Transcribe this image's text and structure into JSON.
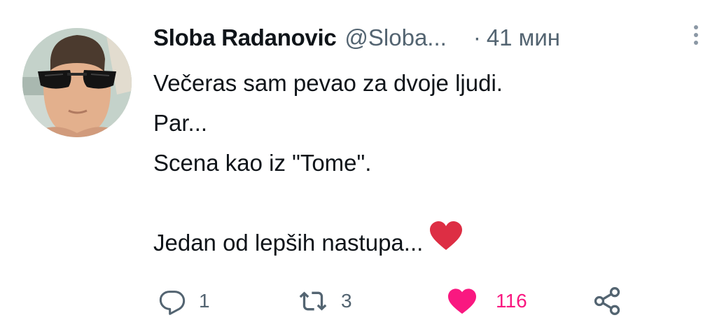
{
  "tweet": {
    "author": {
      "display_name": "Sloba Radanovic",
      "handle": "@Sloba...",
      "avatar": "profile-photo"
    },
    "separator": "·",
    "time": "41 мин",
    "lines": [
      "Večeras sam pevao za dvoje ljudi.",
      "Par...",
      "Scena kao iz \"Tome\".",
      "",
      "Jedan od lepših nastupa..."
    ],
    "trailing_emoji": "red-heart"
  },
  "actions": {
    "reply": {
      "icon": "reply-icon",
      "count": "1"
    },
    "retweet": {
      "icon": "retweet-icon",
      "count": "3"
    },
    "like": {
      "icon": "heart-icon",
      "count": "116",
      "active": true
    },
    "share": {
      "icon": "share-icon"
    }
  },
  "colors": {
    "text": "#0f1419",
    "muted": "#536471",
    "like_active": "#f91880",
    "emoji_heart": "#dd2e44"
  }
}
